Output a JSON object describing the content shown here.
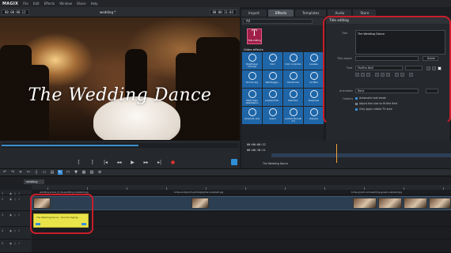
{
  "app": {
    "logo": "MAGIX",
    "menu": [
      "File",
      "Edit",
      "Effects",
      "Window",
      "Share",
      "Help"
    ]
  },
  "preview": {
    "timecode_left": "00:00:00:12",
    "project_name": "wedding *",
    "timecode_right": "00:00:11:03",
    "overlay_title": "The Wedding Dance",
    "progress": 0.58
  },
  "tabs": [
    {
      "label": "Import",
      "active": false
    },
    {
      "label": "Effects",
      "active": true
    },
    {
      "label": "Templates",
      "active": false
    },
    {
      "label": "Audio",
      "active": false
    },
    {
      "label": "Store",
      "active": false
    }
  ],
  "effects": {
    "category_select": "All",
    "title_editing_button": "Title editing",
    "video_effects_header": "Video effects",
    "items": [
      "Brightness/ Contrast",
      "Color",
      "Color correction",
      "Lossless",
      "Chroma key",
      "Wedding/go...",
      "Transformer",
      "Art filter",
      "HDR/ Video stabilization",
      "Lossless Edit...",
      "Distortion",
      "Sharpness",
      "Cinematic look",
      "Speed",
      "proDAD Mercalli 2.0",
      "Dissolve"
    ]
  },
  "title_editing": {
    "header": "Title editing",
    "title_label": "Title",
    "title_value": "The Wedding Dance",
    "object_label": "Title object",
    "object_button": "Delete",
    "font_label": "Font",
    "font_value": "Pacifico Bold",
    "animation_label": "Animation",
    "animation_value": "None",
    "options_label": "Options",
    "options": [
      {
        "label": "Automatic text break",
        "checked": true
      },
      {
        "label": "Adjust font size to fit title field",
        "checked": false
      },
      {
        "label": "Only apply visible TV area",
        "checked": true
      }
    ]
  },
  "mini_preview": {
    "timecode1": "00:00:00:12",
    "timecode2": "00:00:10:11",
    "clip_name": "The Wedding Dance"
  },
  "timeline": {
    "sequence_tab": "wedding",
    "tracks": [
      "1",
      "2",
      "3",
      "4",
      "5"
    ],
    "clip_labels": [
      "wedding-scene_6_ide-wedding-unsplash.jpg",
      "bride-and-groom-photographer-unsplash.jpg",
      "bride-groom-and-wedding-guest-unsplash.jpg"
    ],
    "title_clip_text": "The Wedding Dance - Scroll & Highlig..."
  },
  "colors": {
    "accent_blue": "#3b8fd6",
    "title_button": "#a0204a",
    "highlight_red": "#c81e2a",
    "title_clip_yellow": "#e9e44a"
  }
}
